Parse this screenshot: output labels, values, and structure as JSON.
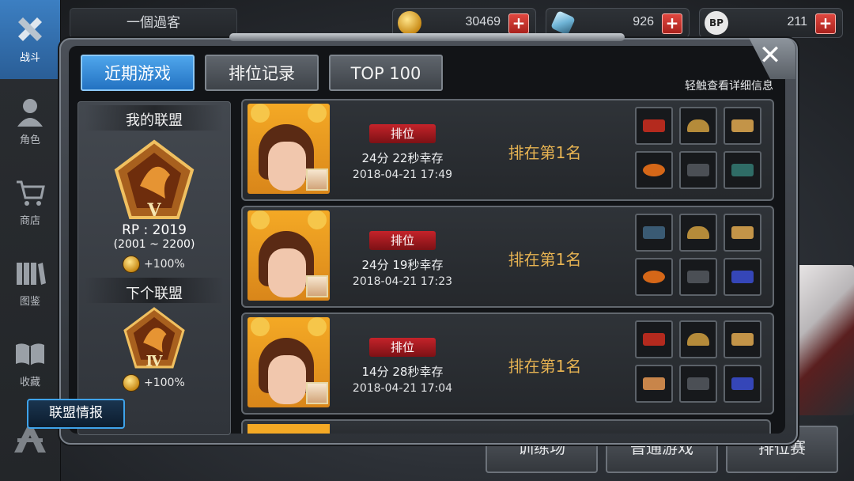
{
  "side_nav": [
    {
      "label": "战斗",
      "icon": "crossed-guns-icon",
      "active": true
    },
    {
      "label": "角色",
      "icon": "character-icon",
      "active": false
    },
    {
      "label": "商店",
      "icon": "cart-icon",
      "active": false
    },
    {
      "label": "图鉴",
      "icon": "books-icon",
      "active": false
    },
    {
      "label": "收藏",
      "icon": "open-book-icon",
      "active": false
    }
  ],
  "header": {
    "player_name": "一個過客",
    "gold": "30469",
    "crystal": "926",
    "bp": "211",
    "bp_icon_text": "BP"
  },
  "bottom_buttons": [
    "训练场",
    "普通游戏",
    "排位赛"
  ],
  "modal": {
    "tabs": [
      {
        "label": "近期游戏",
        "active": true
      },
      {
        "label": "排位记录",
        "active": false
      },
      {
        "label": "TOP 100",
        "active": false
      }
    ],
    "hint": "轻触查看详细信息",
    "league": {
      "my_title": "我的联盟",
      "my_tier": "V",
      "rp": "RP : 2019",
      "rp_range": "(2001 ~ 2200)",
      "my_bonus": "+100%",
      "next_title": "下个联盟",
      "next_tier": "Ⅳ",
      "next_bonus": "+100%",
      "button": "联盟情报"
    },
    "matches": [
      {
        "mode": "排位",
        "duration": "24分 22秒幸存",
        "date": "2018-04-21 17:49",
        "rank": "排在第1名"
      },
      {
        "mode": "排位",
        "duration": "24分 19秒幸存",
        "date": "2018-04-21 17:23",
        "rank": "排在第1名"
      },
      {
        "mode": "排位",
        "duration": "14分 28秒幸存",
        "date": "2018-04-21 17:04",
        "rank": "排在第1名"
      }
    ]
  }
}
